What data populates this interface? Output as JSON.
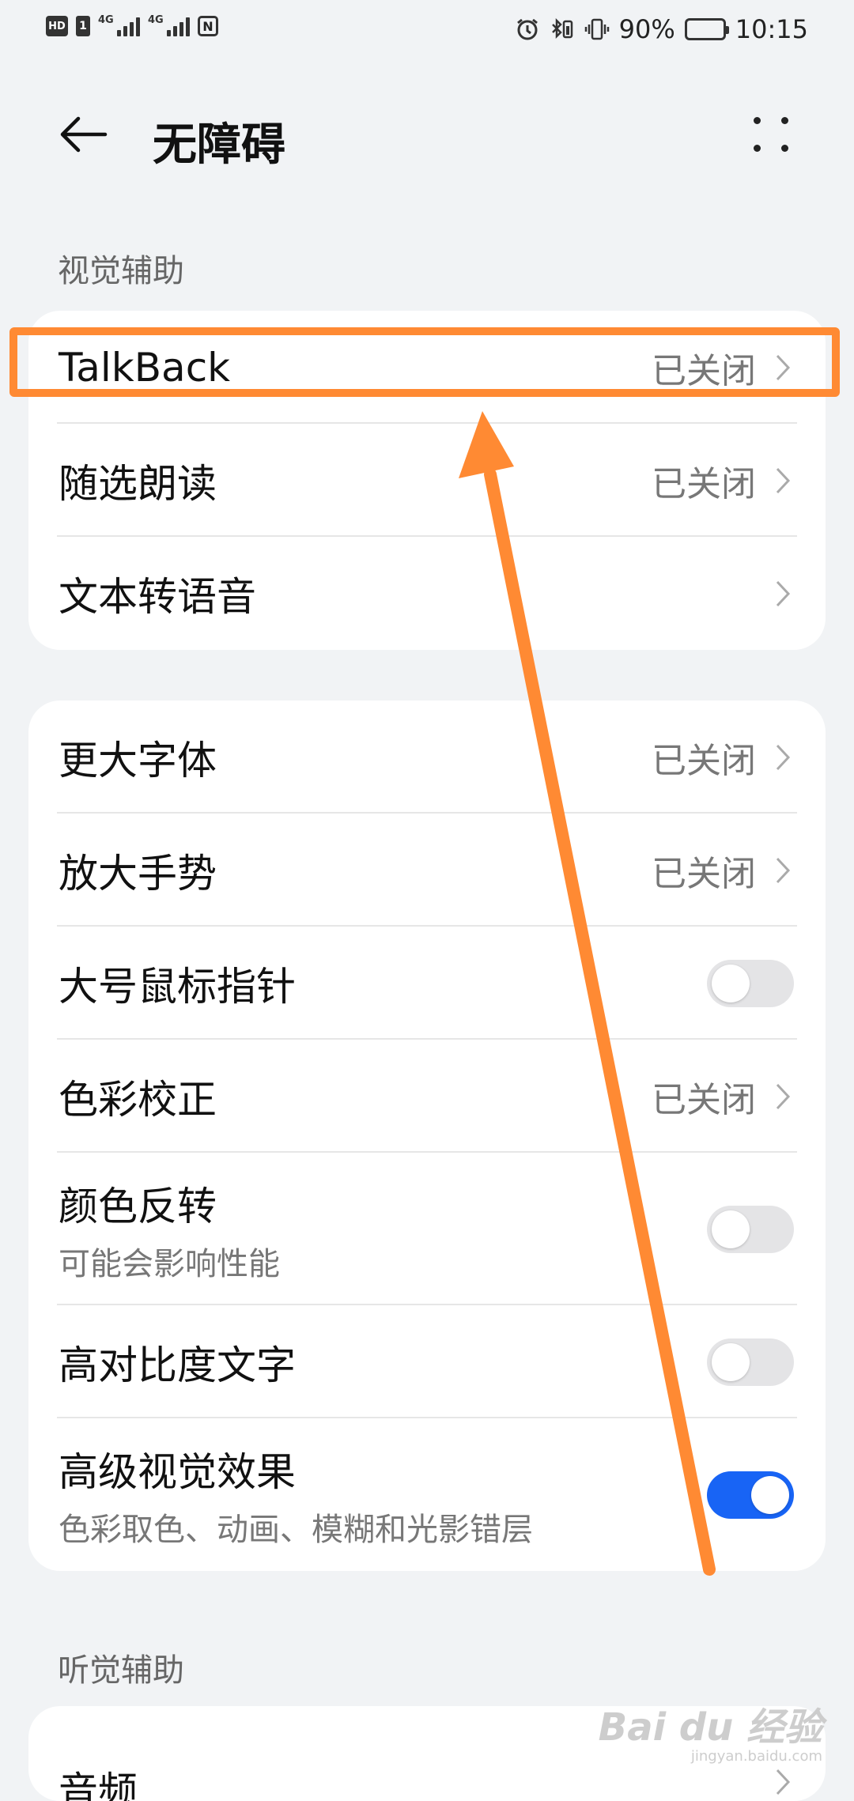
{
  "status_bar": {
    "left": {
      "hd": "HD",
      "sim": "1",
      "net1": "4G",
      "net2": "4G",
      "nfc": "N"
    },
    "battery_percent": "90%",
    "time": "10:15"
  },
  "header": {
    "title": "无障碍"
  },
  "sections": [
    {
      "label": "视觉辅助"
    },
    {
      "label": "听觉辅助"
    }
  ],
  "card1": {
    "rows": [
      {
        "title": "TalkBack",
        "status": "已关闭"
      },
      {
        "title": "随选朗读",
        "status": "已关闭"
      },
      {
        "title": "文本转语音"
      }
    ]
  },
  "card2": {
    "rows": [
      {
        "title": "更大字体",
        "status": "已关闭"
      },
      {
        "title": "放大手势",
        "status": "已关闭"
      },
      {
        "title": "大号鼠标指针",
        "toggle": false
      },
      {
        "title": "色彩校正",
        "status": "已关闭"
      },
      {
        "title": "颜色反转",
        "subtitle": "可能会影响性能",
        "toggle": false
      },
      {
        "title": "高对比度文字",
        "toggle": false
      },
      {
        "title": "高级视觉效果",
        "subtitle": "色彩取色、动画、模糊和光影错层",
        "toggle": true
      }
    ]
  },
  "card3": {
    "rows": [
      {
        "title": "音频"
      }
    ]
  },
  "annotation": {
    "color": "#ff8a33"
  },
  "watermark": {
    "logo": "Bai du 经验",
    "url": "jingyan.baidu.com"
  },
  "colors": {
    "toggle_on": "#1864f5",
    "background": "#f1f3f5"
  }
}
